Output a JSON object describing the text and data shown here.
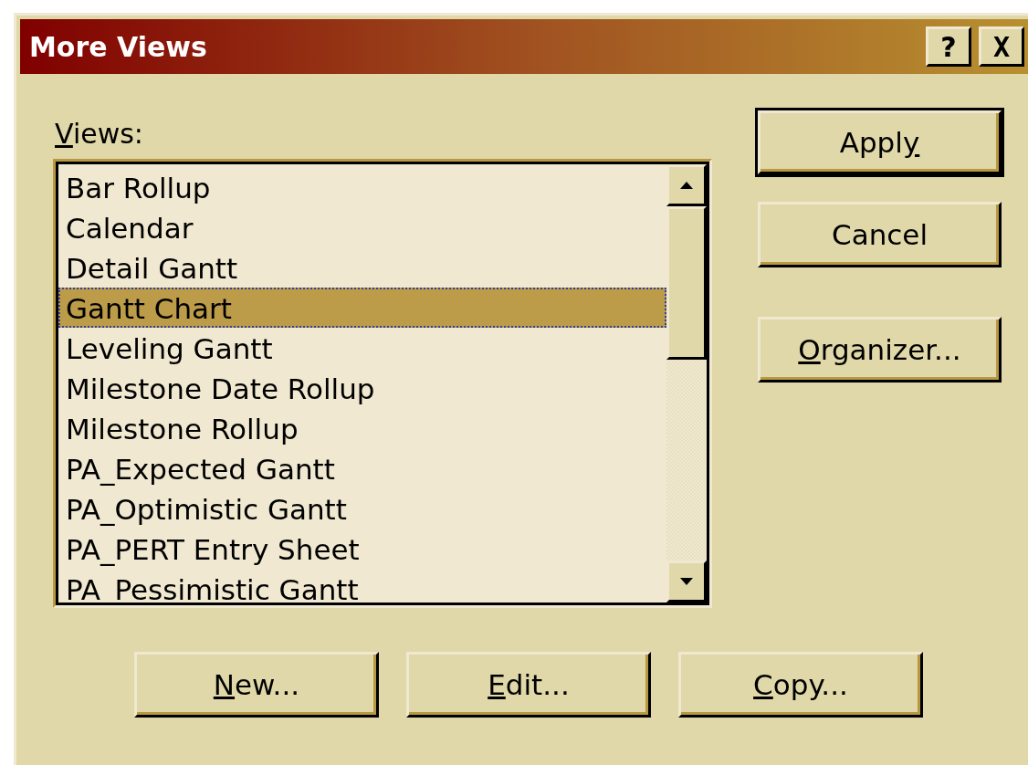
{
  "window": {
    "title": "More Views",
    "title_buttons": [
      {
        "kind": "help",
        "label": "?"
      },
      {
        "kind": "close",
        "label": "X"
      }
    ]
  },
  "views_label": {
    "key": "V",
    "after": "iews:"
  },
  "views": [
    {
      "label": "Bar Rollup",
      "selected": false
    },
    {
      "label": "Calendar",
      "selected": false
    },
    {
      "label": "Detail Gantt",
      "selected": false
    },
    {
      "label": "Gantt Chart",
      "selected": true
    },
    {
      "label": "Leveling Gantt",
      "selected": false
    },
    {
      "label": "Milestone Date Rollup",
      "selected": false
    },
    {
      "label": "Milestone Rollup",
      "selected": false
    },
    {
      "label": "PA_Expected Gantt",
      "selected": false
    },
    {
      "label": "PA_Optimistic Gantt",
      "selected": false
    },
    {
      "label": "PA_PERT Entry Sheet",
      "selected": false
    },
    {
      "label": "PA_Pessimistic Gantt",
      "selected": false
    }
  ],
  "side_buttons": [
    {
      "before": "Appl",
      "key": "y",
      "default": true
    },
    {
      "before": "Cancel",
      "default": false
    },
    {
      "key": "O",
      "after": "rganizer...",
      "default": false
    }
  ],
  "bottom_buttons": [
    {
      "key": "N",
      "after": "ew..."
    },
    {
      "key": "E",
      "after": "dit..."
    },
    {
      "key": "C",
      "after": "opy..."
    }
  ]
}
